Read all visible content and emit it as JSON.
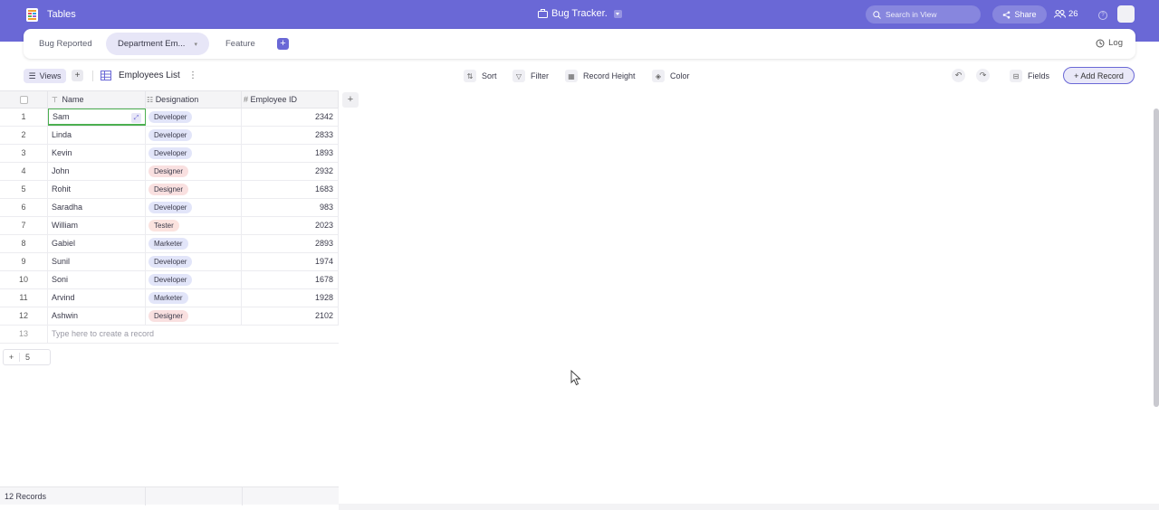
{
  "app": {
    "title": "Tables",
    "base_title": "Bug Tracker."
  },
  "header": {
    "search_placeholder": "Search in View",
    "share_label": "Share",
    "users_count": "26"
  },
  "tabs": [
    {
      "label": "Bug Reported",
      "active": false
    },
    {
      "label": "Department Em...",
      "active": true
    },
    {
      "label": "Feature",
      "active": false
    }
  ],
  "log_label": "Log",
  "toolbar": {
    "views_label": "Views",
    "view_name": "Employees List",
    "sort_label": "Sort",
    "filter_label": "Filter",
    "record_height_label": "Record Height",
    "color_label": "Color",
    "fields_label": "Fields",
    "add_record_label": "+ Add Record"
  },
  "columns": [
    {
      "label": "Name"
    },
    {
      "label": "Designation"
    },
    {
      "label": "Employee ID"
    }
  ],
  "rows": [
    {
      "n": "1",
      "name": "Sam",
      "designation": "Developer",
      "id": "2342"
    },
    {
      "n": "2",
      "name": "Linda",
      "designation": "Developer",
      "id": "2833"
    },
    {
      "n": "3",
      "name": "Kevin",
      "designation": "Developer",
      "id": "1893"
    },
    {
      "n": "4",
      "name": "John",
      "designation": "Designer",
      "id": "2932"
    },
    {
      "n": "5",
      "name": "Rohit",
      "designation": "Designer",
      "id": "1683"
    },
    {
      "n": "6",
      "name": "Saradha",
      "designation": "Developer",
      "id": "983"
    },
    {
      "n": "7",
      "name": "William",
      "designation": "Tester",
      "id": "2023"
    },
    {
      "n": "8",
      "name": "Gabiel",
      "designation": "Marketer",
      "id": "2893"
    },
    {
      "n": "9",
      "name": "Sunil",
      "designation": "Developer",
      "id": "1974"
    },
    {
      "n": "10",
      "name": "Soni",
      "designation": "Developer",
      "id": "1678"
    },
    {
      "n": "11",
      "name": "Arvind",
      "designation": "Marketer",
      "id": "1928"
    },
    {
      "n": "12",
      "name": "Ashwin",
      "designation": "Designer",
      "id": "2102"
    }
  ],
  "new_row": {
    "n": "13",
    "placeholder": "Type here to create a record"
  },
  "group_count": "5",
  "footer": {
    "records": "12 Records"
  },
  "colors": {
    "accent": "#6a68d6",
    "developer": "#e2e5f9",
    "designer": "#f9e0e0",
    "selected_border": "#4caf50"
  }
}
